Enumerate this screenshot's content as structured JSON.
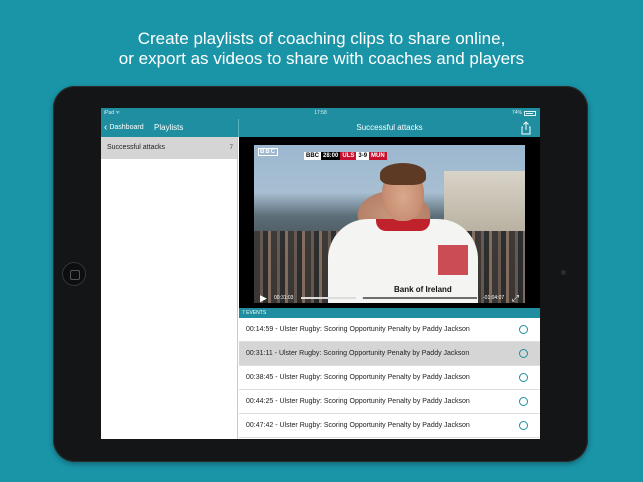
{
  "headline": {
    "line1": "Create playlists of coaching clips to share online,",
    "line2": "or export as videos to share with coaches and players"
  },
  "status_bar": {
    "carrier": "iPad ᯤ",
    "time": "17:58",
    "battery": "74%"
  },
  "navbar": {
    "back_label": "Dashboard",
    "left_title": "Playlists",
    "right_title": "Successful attacks",
    "share_icon": "share-icon"
  },
  "sidebar": {
    "items": [
      {
        "label": "Successful attacks",
        "count": "7"
      }
    ]
  },
  "video": {
    "broadcaster": "BBC",
    "scorebug": {
      "bbc": "BBC",
      "clock": "28:00",
      "home": "ULS",
      "score": "3-9",
      "away": "MUN"
    },
    "sponsor": "Bank of Ireland",
    "current_time": "00:31:03",
    "remaining_time": "-01:04:07",
    "progress": 0.33
  },
  "events": {
    "header": "7 EVENTS",
    "items": [
      {
        "label": "00:14:59 - Ulster Rugby: Scoring Opportunity Penalty by Paddy Jackson",
        "selected": false
      },
      {
        "label": "00:31:11 - Ulster Rugby: Scoring Opportunity Penalty by Paddy Jackson",
        "selected": true
      },
      {
        "label": "00:38:45 - Ulster Rugby: Scoring Opportunity Penalty by Paddy Jackson",
        "selected": false
      },
      {
        "label": "00:44:25 - Ulster Rugby: Scoring Opportunity Penalty by Paddy Jackson",
        "selected": false
      },
      {
        "label": "00:47:42 - Ulster Rugby: Scoring Opportunity Penalty by Paddy Jackson",
        "selected": false
      }
    ]
  },
  "colors": {
    "background": "#1a95a8",
    "accent": "#1e8ea0",
    "selected_row": "#d5d5d5"
  }
}
